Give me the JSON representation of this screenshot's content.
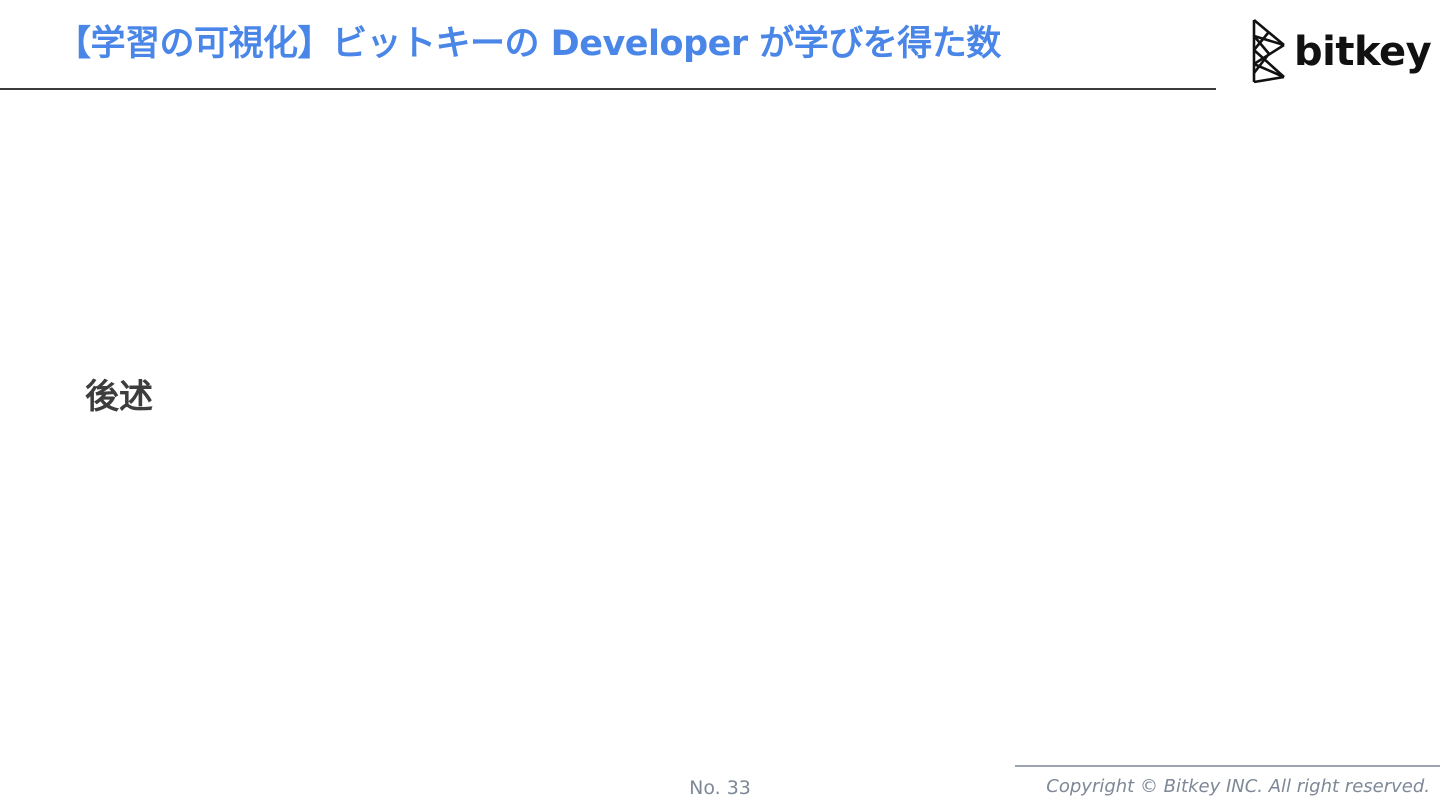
{
  "slide": {
    "title": "【学習の可視化】ビットキーの Developer が学びを得た数",
    "body_text": "後述",
    "page_number": "No. 33",
    "copyright": "Copyright © Bitkey INC. All right reserved."
  },
  "logo": {
    "wordmark": "bitkey",
    "icon": "bitkey-logo-icon"
  },
  "colors": {
    "title": "#4a86e8",
    "body_text": "#3d3d3d",
    "footer_text": "#7e8896",
    "rule": "#3c3c3c"
  }
}
